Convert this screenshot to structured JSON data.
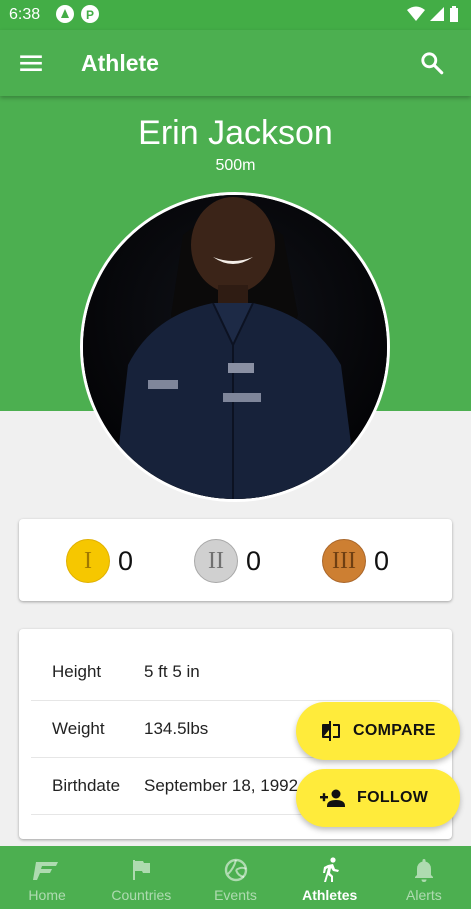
{
  "status": {
    "time": "6:38"
  },
  "app_bar": {
    "title": "Athlete",
    "menu_icon": "menu-icon",
    "search_icon": "search-icon"
  },
  "athlete": {
    "name": "Erin Jackson",
    "event": "500m"
  },
  "medals": [
    {
      "label": "I",
      "count": "0",
      "color": "#f6c700",
      "border": "#e0b000",
      "text_color": "#a07800"
    },
    {
      "label": "II",
      "count": "0",
      "color": "#d0d0d0",
      "border": "#a8a8a8",
      "text_color": "#707070"
    },
    {
      "label": "III",
      "count": "0",
      "color": "#cd7f32",
      "border": "#a9662a",
      "text_color": "#6f3f12"
    }
  ],
  "info": [
    {
      "label": "Height",
      "value": "5 ft 5 in"
    },
    {
      "label": "Weight",
      "value": "134.5lbs"
    },
    {
      "label": "Birthdate",
      "value": "September 18, 1992"
    }
  ],
  "actions": {
    "compare": "COMPARE",
    "follow": "FOLLOW"
  },
  "nav": [
    {
      "label": "Home",
      "icon": "home-logo-icon",
      "active": false
    },
    {
      "label": "Countries",
      "icon": "flag-icon",
      "active": false
    },
    {
      "label": "Events",
      "icon": "volleyball-icon",
      "active": false
    },
    {
      "label": "Athletes",
      "icon": "running-person-icon",
      "active": true
    },
    {
      "label": "Alerts",
      "icon": "bell-icon",
      "active": false
    }
  ],
  "colors": {
    "primary": "#4caf50",
    "status_bar": "#43ad46",
    "accent": "#ffeb3b"
  }
}
